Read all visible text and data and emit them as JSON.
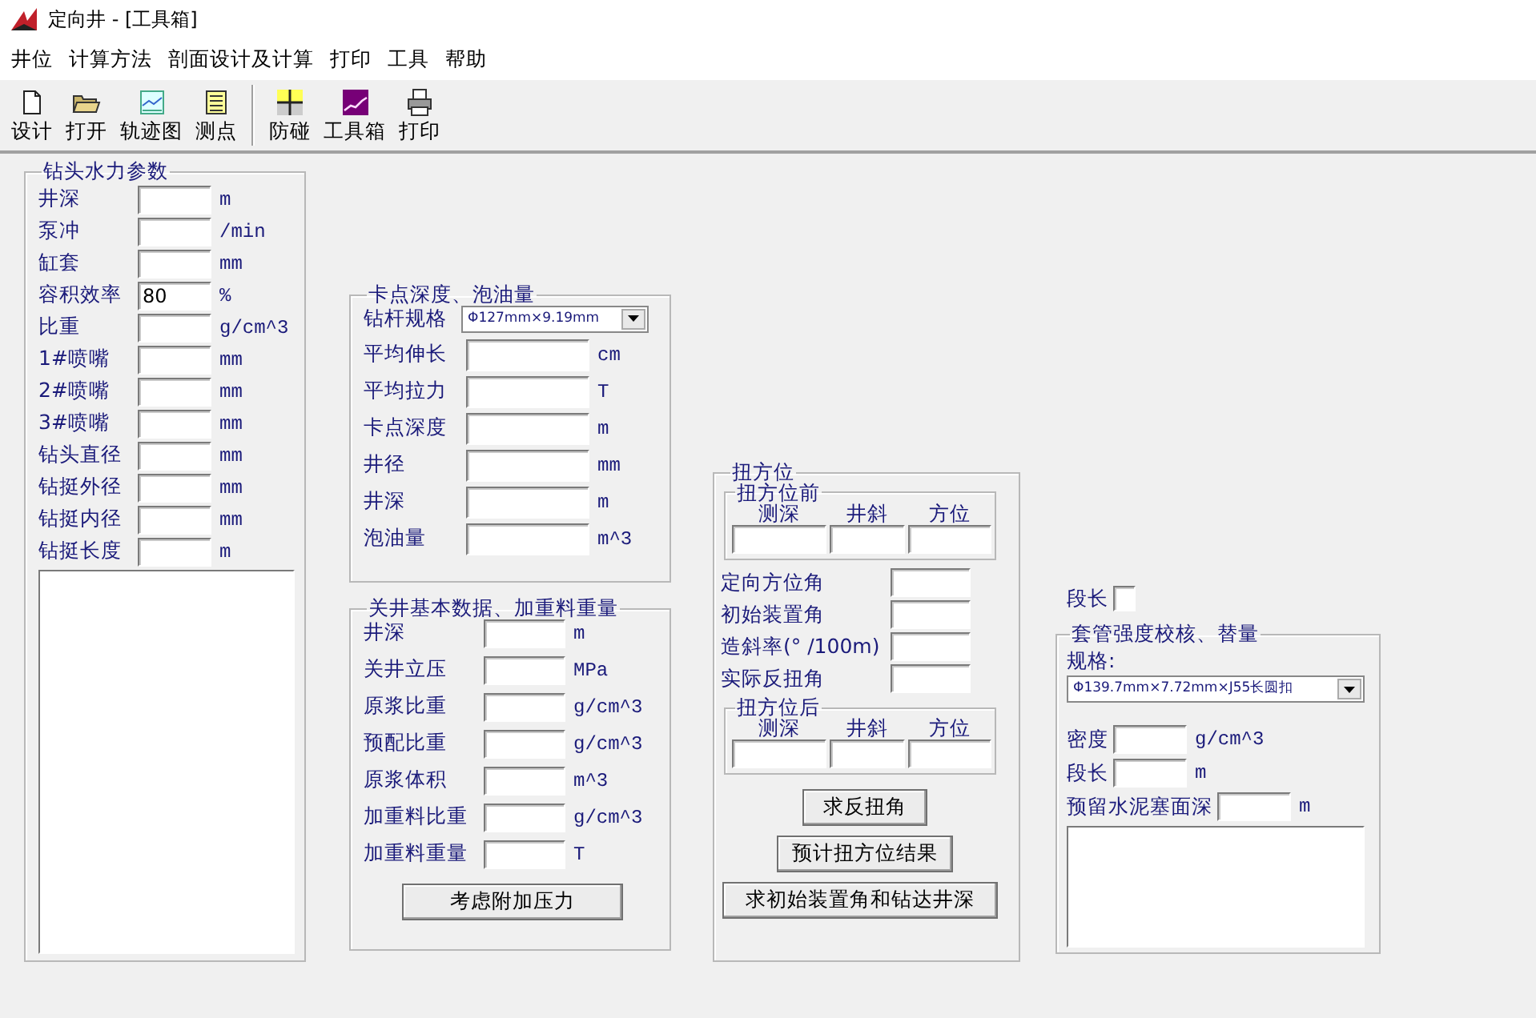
{
  "window": {
    "title": "定向井 - [工具箱]"
  },
  "menu": [
    "井位",
    "计算方法",
    "剖面设计及计算",
    "打印",
    "工具",
    "帮助"
  ],
  "toolbar_groups": [
    [
      {
        "label": "设计"
      },
      {
        "label": "打开"
      },
      {
        "label": "轨迹图"
      },
      {
        "label": "测点"
      }
    ],
    [
      {
        "label": "防碰"
      },
      {
        "label": "工具箱"
      },
      {
        "label": "打印"
      }
    ]
  ],
  "hydraulics": {
    "title": "钻头水力参数",
    "rows": [
      {
        "label": "井深",
        "unit": "m"
      },
      {
        "label": "泵冲",
        "unit": "/min"
      },
      {
        "label": "缸套",
        "unit": "mm"
      },
      {
        "label": "容积效率",
        "value": "80",
        "unit": "%"
      },
      {
        "label": "比重",
        "unit": "g/cm^3"
      },
      {
        "label": "1#喷嘴",
        "unit": "mm"
      },
      {
        "label": "2#喷嘴",
        "unit": "mm"
      },
      {
        "label": "3#喷嘴",
        "unit": "mm"
      },
      {
        "label": "钻头直径",
        "unit": "mm"
      },
      {
        "label": "钻挺外径",
        "unit": "mm"
      },
      {
        "label": "钻挺内径",
        "unit": "mm"
      },
      {
        "label": "钻挺长度",
        "unit": "m"
      }
    ]
  },
  "stuck_point": {
    "title": "卡点深度、泡油量",
    "spec": {
      "label": "钻杆规格",
      "value": "Φ127mm×9.19mm"
    },
    "rows": [
      {
        "label": "平均伸长",
        "unit": "cm"
      },
      {
        "label": "平均拉力",
        "unit": "T"
      },
      {
        "label": "卡点深度",
        "unit": "m"
      },
      {
        "label": "井径",
        "unit": "mm"
      },
      {
        "label": "井深",
        "unit": "m"
      },
      {
        "label": "泡油量",
        "unit": "m^3"
      }
    ]
  },
  "kill": {
    "title": "关井基本数据、加重料重量",
    "rows": [
      {
        "label": "井深",
        "unit": "m"
      },
      {
        "label": "关井立压",
        "unit": "MPa"
      },
      {
        "label": "原浆比重",
        "unit": "g/cm^3"
      },
      {
        "label": "预配比重",
        "unit": "g/cm^3"
      },
      {
        "label": "原浆体积",
        "unit": "m^3"
      },
      {
        "label": "加重料比重",
        "unit": "g/cm^3"
      },
      {
        "label": "加重料重量",
        "unit": "T"
      }
    ],
    "button": "考虑附加压力"
  },
  "azimuth": {
    "title": "扭方位",
    "before": {
      "title": "扭方位前",
      "columns": [
        "测深",
        "井斜",
        "方位"
      ]
    },
    "rows": [
      {
        "label": "定向方位角"
      },
      {
        "label": "初始装置角"
      },
      {
        "label": "造斜率(° /100m)"
      },
      {
        "label": "实际反扭角"
      }
    ],
    "after": {
      "title": "扭方位后",
      "columns": [
        "测深",
        "井斜",
        "方位"
      ]
    },
    "buttons": [
      "求反扭角",
      "预计扭方位结果",
      "求初始装置角和钻达井深"
    ]
  },
  "stray": {
    "label": "段长"
  },
  "casing": {
    "title": "套管强度校核、替量",
    "spec_label": "规格:",
    "spec_value": "Φ139.7mm×7.72mm×J55长圆扣",
    "rows": [
      {
        "label": "密度",
        "unit": "g/cm^3"
      },
      {
        "label": "段长",
        "unit": "m"
      },
      {
        "label": "预留水泥塞面深",
        "unit": "m"
      }
    ]
  }
}
